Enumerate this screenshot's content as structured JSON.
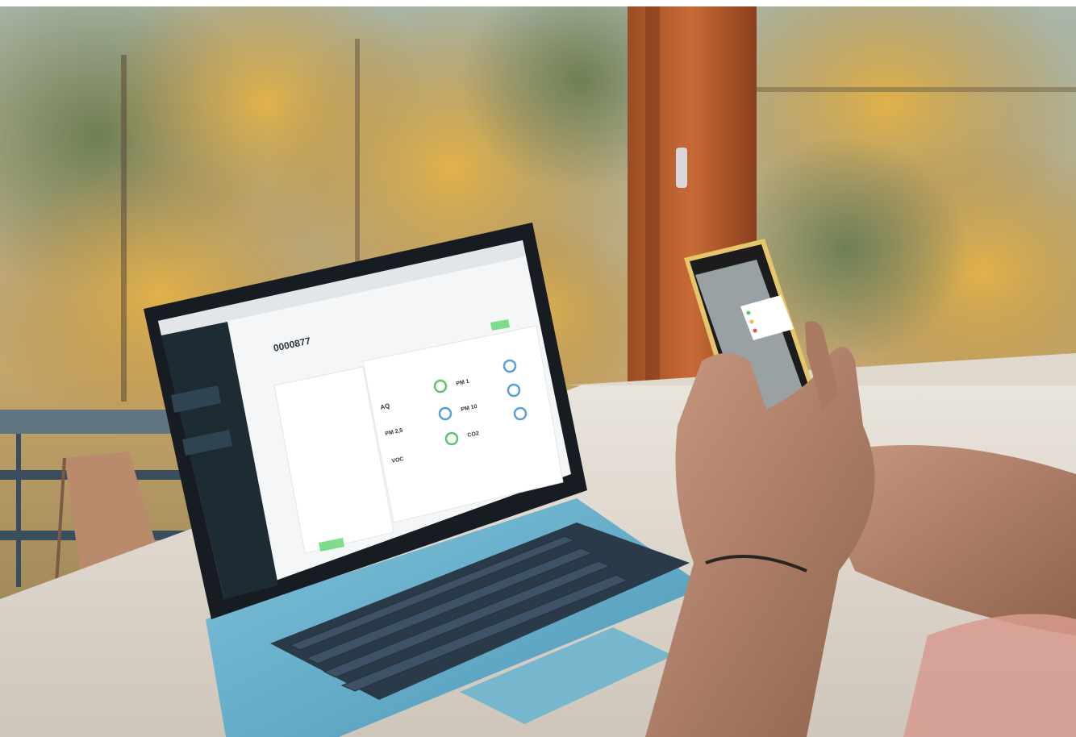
{
  "laptop_screen": {
    "record_id": "0000877",
    "metric_labels": [
      "AQ",
      "PM 2,5",
      "VOC",
      "PM 1",
      "PM 10",
      "CO2"
    ],
    "status_badge_color": "#7fdc8a",
    "ring_colors": [
      "#5cc46a",
      "#5a9fd4",
      "#5cc46a"
    ]
  },
  "colors": {
    "sidebar": "#1d2b33",
    "accent": "#66d38e",
    "laptop_body": "#5ba7c3"
  }
}
